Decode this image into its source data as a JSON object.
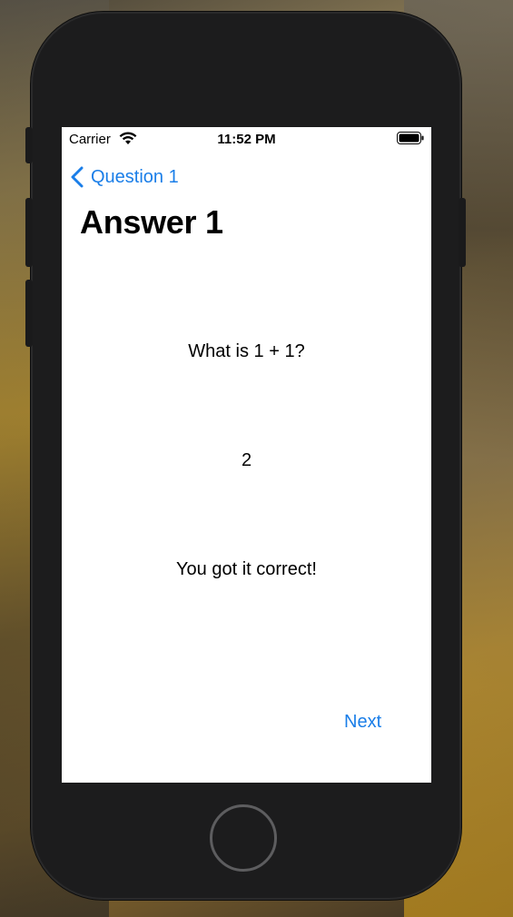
{
  "status_bar": {
    "carrier": "Carrier",
    "time": "11:52 PM",
    "wifi_icon": "wifi-icon",
    "battery_icon": "battery-icon"
  },
  "nav": {
    "back_label": "Question 1",
    "back_icon": "chevron-left-icon",
    "title": "Answer 1"
  },
  "content": {
    "question": "What is 1 + 1?",
    "answer": "2",
    "result": "You got it correct!"
  },
  "actions": {
    "next_label": "Next"
  },
  "colors": {
    "accent": "#1a7ee8",
    "device": "#1c1c1d",
    "screen_bg": "#ffffff"
  }
}
